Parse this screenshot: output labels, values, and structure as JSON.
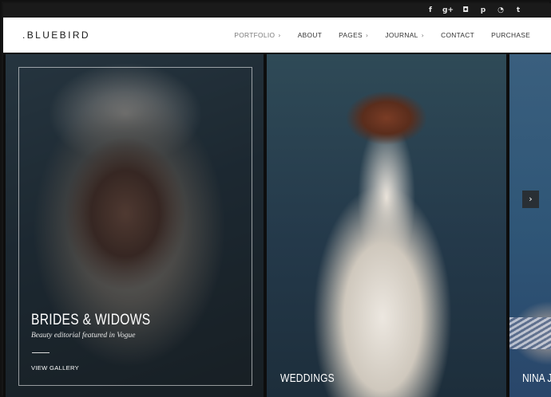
{
  "social": {
    "icons": [
      {
        "name": "facebook-icon",
        "glyph": "f"
      },
      {
        "name": "google-plus-icon",
        "glyph": "g+"
      },
      {
        "name": "instagram-icon",
        "glyph": "◘"
      },
      {
        "name": "pinterest-icon",
        "glyph": "p"
      },
      {
        "name": "rss-icon",
        "glyph": "◔"
      },
      {
        "name": "twitter-icon",
        "glyph": "t"
      }
    ]
  },
  "header": {
    "logo": ".BLUEBIRD",
    "nav": [
      {
        "label": "PORTFOLIO",
        "chevron": "›",
        "active": true
      },
      {
        "label": "ABOUT",
        "chevron": ""
      },
      {
        "label": "PAGES",
        "chevron": "›"
      },
      {
        "label": "JOURNAL",
        "chevron": "›"
      },
      {
        "label": "CONTACT",
        "chevron": ""
      },
      {
        "label": "PURCHASE",
        "chevron": ""
      }
    ]
  },
  "slides": {
    "first": {
      "title": "BRIDES & WIDOWS",
      "subtitle": "Beauty editorial featured in Vogue",
      "link": "VIEW GALLERY"
    },
    "second": {
      "title": "WEDDINGS"
    },
    "third": {
      "title": "NINA JI"
    }
  },
  "controls": {
    "next": "›"
  }
}
